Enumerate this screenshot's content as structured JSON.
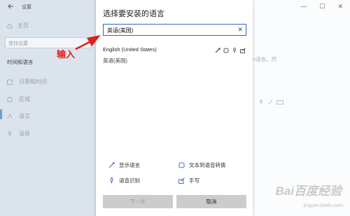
{
  "settings": {
    "title": "设置",
    "home": "主页",
    "search_placeholder": "查找设置",
    "section": "时间和语言",
    "nav": [
      {
        "label": "日期和时间",
        "icon": "calendar-clock-icon"
      },
      {
        "label": "区域",
        "icon": "globe-icon"
      },
      {
        "label": "语言",
        "icon": "language-icon"
      },
      {
        "label": "语音",
        "icon": "microphone-icon"
      }
    ],
    "right_snippet": "n语言。然",
    "window_controls": [
      "—",
      "☐",
      "✕"
    ]
  },
  "dialog": {
    "title": "选择要安装的语言",
    "search_value": "英语(美国)",
    "clear": "✕",
    "result": {
      "name": "English (United States)",
      "native": "英语(美国)",
      "feature_icons": [
        "display-language-icon",
        "text-to-speech-icon",
        "speech-recognition-icon",
        "handwriting-icon"
      ]
    },
    "legend": [
      {
        "label": "显示语言",
        "icon": "display-language-icon"
      },
      {
        "label": "文本到语音转换",
        "icon": "text-to-speech-icon"
      },
      {
        "label": "语音识别",
        "icon": "speech-recognition-icon"
      },
      {
        "label": "手写",
        "icon": "handwriting-icon"
      }
    ],
    "next_label": "下一步",
    "cancel_label": "取消"
  },
  "annotation": {
    "text": "输入"
  },
  "watermark": {
    "text": "Bai百度经验",
    "sub": "jingyan.baidu.com"
  },
  "colors": {
    "accent": "#2a66c4",
    "annotation": "#e0201a",
    "sidebar": "#dbe3ec"
  }
}
